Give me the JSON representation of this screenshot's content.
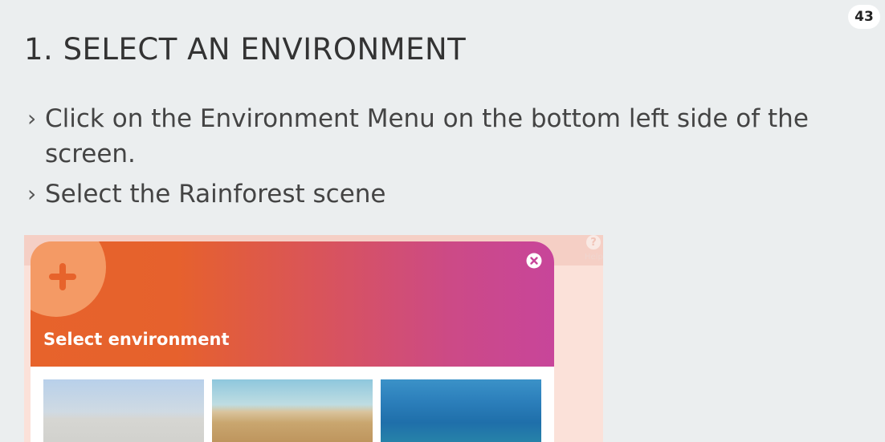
{
  "page_number": "43",
  "title": "1. SELECT AN ENVIRONMENT",
  "bullets": [
    {
      "marker": "›",
      "text": "Click on the Environment Menu on the bottom left side of the screen."
    },
    {
      "marker": "›",
      "text": "Select the Rainforest scene"
    }
  ],
  "screenshot": {
    "help_label": "Help",
    "help_glyph": "?",
    "modal": {
      "title": "Select environment",
      "plus_icon": "plus-icon",
      "close_icon": "close-icon",
      "thumbnails": [
        {
          "name": "snow",
          "colors": [
            "#b8d0ea",
            "#d6d6d2"
          ]
        },
        {
          "name": "desert",
          "colors": [
            "#8ec7dd",
            "#c9a66f"
          ]
        },
        {
          "name": "ocean",
          "colors": [
            "#3b92c8",
            "#1f6faa"
          ]
        }
      ],
      "header_gradient": [
        "#e7632b",
        "#c8459a"
      ]
    }
  },
  "colors": {
    "background": "#ebeeef",
    "text": "#444444",
    "accent": "#e7632b"
  }
}
